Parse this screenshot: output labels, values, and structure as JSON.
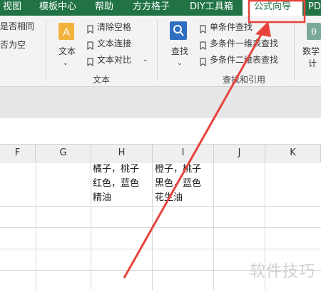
{
  "tabs": [
    "视图",
    "模板中心",
    "帮助",
    "方方格子",
    "DIY工具箱",
    "公式向导",
    "PD"
  ],
  "active_tab": "公式向导",
  "ribbon": {
    "partial_left": [
      "是否相同",
      "否为空"
    ],
    "text_group": {
      "big_button": "文本",
      "items": [
        "清除空格",
        "文本连接",
        "文本对比"
      ],
      "label": "文本"
    },
    "lookup_group": {
      "big_button": "查找",
      "items": [
        "单条件查找",
        "多条件一维表查找",
        "多条件二维表查找"
      ],
      "label": "查找和引用"
    },
    "partial_right": [
      "数学",
      "计"
    ]
  },
  "columns": [
    "F",
    "G",
    "H",
    "I",
    "J",
    "K"
  ],
  "cells": {
    "H1": "橘子，桃子\n红色，蓝色\n精油",
    "I1": "橙子，桃子\n黑色，蓝色\n花生油"
  },
  "watermark": "软件技巧",
  "colors": {
    "tab_green": "#217346",
    "annotation_red": "#e8433b",
    "icon_blue": "#2f6fc1"
  }
}
